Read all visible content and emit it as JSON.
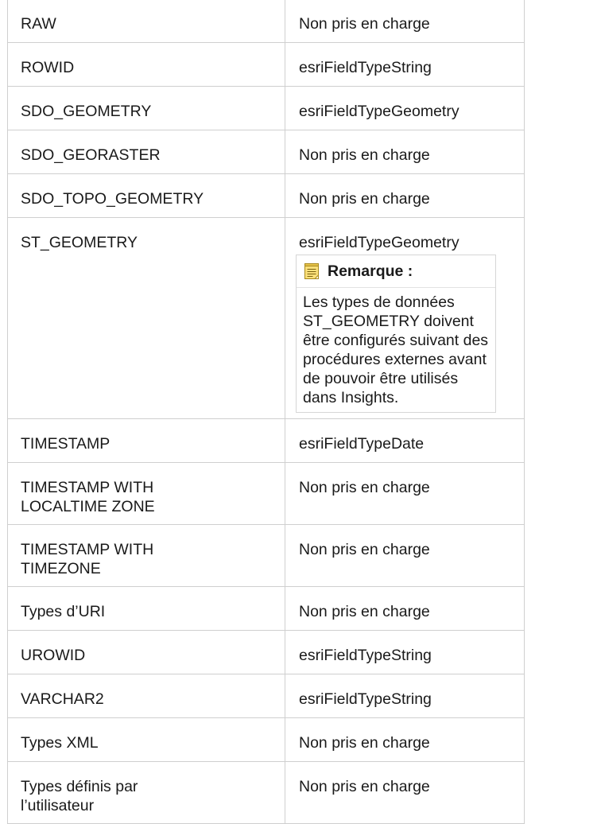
{
  "rows": [
    {
      "type": "RAW",
      "mapping": "Non pris en charge"
    },
    {
      "type": "ROWID",
      "mapping": "esriFieldTypeString"
    },
    {
      "type": "SDO_GEOMETRY",
      "mapping": "esriFieldTypeGeometry"
    },
    {
      "type": "SDO_GEORASTER",
      "mapping": "Non pris en charge"
    },
    {
      "type": "SDO_TOPO_GEOMETRY",
      "mapping": "Non pris en charge"
    },
    {
      "type": "ST_GEOMETRY",
      "mapping": "esriFieldTypeGeometry",
      "note": {
        "title": "Remarque :",
        "icon": "note-icon",
        "text": "Les types de données ST_GEOMETRY doivent être configurés suivant des procédures externes avant de pouvoir être utilisés dans Insights."
      }
    },
    {
      "type": "TIMESTAMP",
      "mapping": "esriFieldTypeDate"
    },
    {
      "type": "TIMESTAMP WITH LOCALTIME ZONE",
      "mapping": "Non pris en charge"
    },
    {
      "type": "TIMESTAMP WITH TIMEZONE",
      "mapping": "Non pris en charge"
    },
    {
      "type": "Types d’URI",
      "mapping": "Non pris en charge"
    },
    {
      "type": "UROWID",
      "mapping": "esriFieldTypeString"
    },
    {
      "type": "VARCHAR2",
      "mapping": "esriFieldTypeString"
    },
    {
      "type": "Types XML",
      "mapping": "Non pris en charge"
    },
    {
      "type": "Types définis par l’utilisateur",
      "mapping": "Non pris en charge"
    }
  ]
}
